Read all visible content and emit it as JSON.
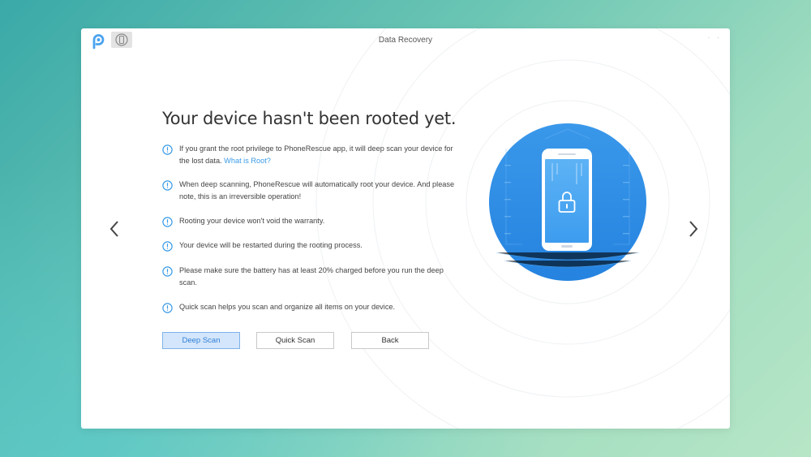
{
  "window": {
    "title": "Data Recovery",
    "controls": "· ·"
  },
  "icons": {
    "logo": "phonerescue-logo-icon",
    "device": "device-icon",
    "prev": "chevron-left-icon",
    "next": "chevron-right-icon",
    "tip": "info-circle-icon",
    "lock": "lock-icon"
  },
  "main": {
    "heading": "Your device hasn't been rooted yet.",
    "tips": [
      {
        "text": "If you grant the root privilege to PhoneRescue app, it will deep scan your device for the lost data.",
        "link": "What is Root?"
      },
      {
        "text": "When deep scanning, PhoneRescue will automatically root your device. And please note, this is an irreversible operation!"
      },
      {
        "text": "Rooting your device won't void the warranty."
      },
      {
        "text": "Your device will be restarted during the rooting process."
      },
      {
        "text": "Please make sure the battery has at least 20% charged before you run the deep scan."
      },
      {
        "text": "Quick scan helps you scan and organize all items on your device."
      }
    ],
    "buttons": {
      "deep_scan": "Deep Scan",
      "quick_scan": "Quick Scan",
      "back": "Back"
    }
  },
  "colors": {
    "accent": "#3a9be8",
    "circle": "#2f8fe6",
    "primary_button_bg": "#d4e6fb"
  }
}
